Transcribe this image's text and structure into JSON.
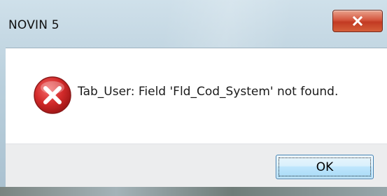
{
  "window": {
    "title": "NOVIN 5"
  },
  "titlebar": {
    "close_icon": "close-x-icon"
  },
  "dialog": {
    "icon": "error-icon",
    "message": "Tab_User: Field 'Fld_Cod_System' not found."
  },
  "buttons": {
    "ok_label": "OK"
  },
  "colors": {
    "close_button": "#c8442b",
    "error_icon": "#c8202a",
    "ok_button_border": "#3c7fb1"
  }
}
